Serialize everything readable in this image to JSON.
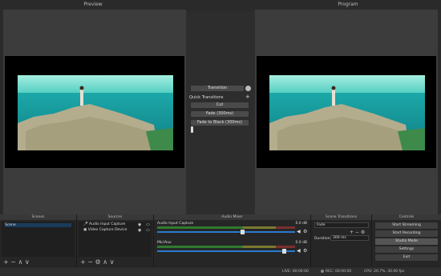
{
  "headers": {
    "preview": "Preview",
    "program": "Program"
  },
  "transition": {
    "transition_btn": "Transition",
    "quick_transitions": "Quick Transitions",
    "add": "+",
    "items": [
      "Cut",
      "Fade (300ms)",
      "Fade to Black (300ms)"
    ]
  },
  "docks": {
    "scenes": {
      "title": "Scenes",
      "items": [
        "Scene"
      ],
      "footer": "+ − ∧ ∨"
    },
    "sources": {
      "title": "Sources",
      "items": [
        {
          "name": "Audio Input Capture",
          "icon": "microphone-icon"
        },
        {
          "name": "Video Capture Device",
          "icon": "camera-icon"
        }
      ],
      "footer": "+ − ⚙ ∧ ∨"
    },
    "mixer": {
      "title": "Audio Mixer",
      "channels": [
        {
          "name": "Audio Input Capture",
          "db": "0.0 dB"
        },
        {
          "name": "Mic/Aux",
          "db": "0.0 dB"
        }
      ]
    },
    "scene_transitions": {
      "title": "Scene Transitions",
      "transition": "Fade",
      "duration_label": "Duration",
      "duration": "300 ms"
    },
    "controls": {
      "title": "Controls",
      "buttons": [
        "Start Streaming",
        "Start Recording",
        "Studio Mode",
        "Settings",
        "Exit"
      ]
    }
  },
  "status": {
    "live": "LIVE: 00:00:00",
    "rec": "REC: 00:00:00",
    "cpu": "CPU: 20.7%, 30.00 fps"
  },
  "colors": {
    "sea": "#1fb5b0",
    "sky": "#7fe6cf",
    "rock": "#b7b08e"
  }
}
